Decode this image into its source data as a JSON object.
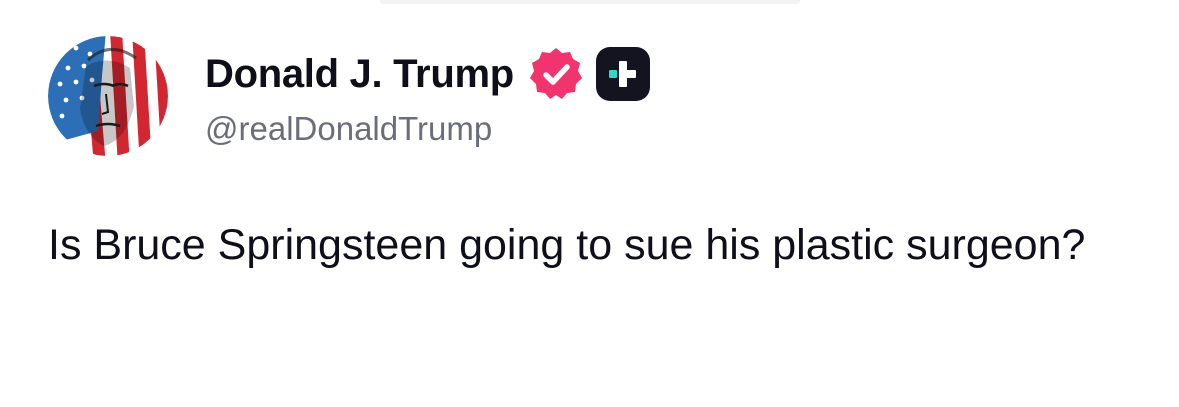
{
  "post": {
    "author": {
      "display_name": "Donald J. Trump",
      "handle": "@realDonaldTrump",
      "verified_badge_color": "#f2346e",
      "plus_badge_color": "#141420",
      "plus_badge_accent": "#2fd9c9"
    },
    "text": "Is Bruce Springsteen going to sue his plastic surgeon?"
  },
  "icons": {
    "avatar": "flag-portrait-avatar",
    "verified": "verified-check-icon",
    "plus": "truth-plus-icon"
  },
  "colors": {
    "text_primary": "#0f0f1a",
    "text_secondary": "#6b6e7a",
    "background": "#ffffff"
  }
}
